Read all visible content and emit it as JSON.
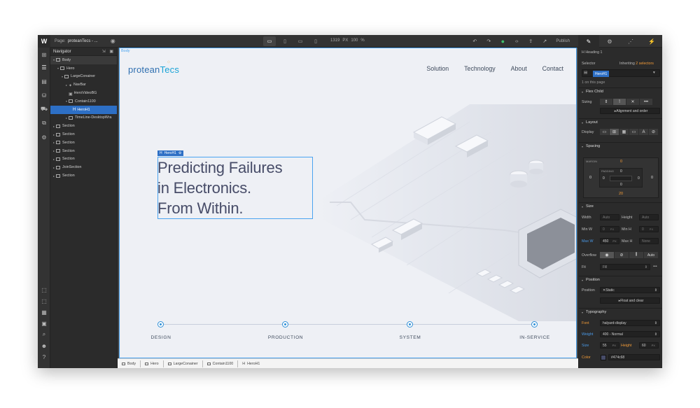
{
  "topbar": {
    "logo": "W",
    "page_label": "Page:",
    "page_name": "proteanTecs - ...",
    "width": "1319",
    "width_unit": "PX",
    "zoom": "100",
    "zoom_unit": "%",
    "publish_label": "Publish"
  },
  "navigator": {
    "title": "Navigator",
    "items": [
      {
        "label": "Body"
      },
      {
        "label": "Hero"
      },
      {
        "label": "LargeConainer"
      },
      {
        "label": "NavBar"
      },
      {
        "label": "HeroVideoBG"
      },
      {
        "label": "Contain1100"
      },
      {
        "label": "HeroH1"
      },
      {
        "label": "TimeLine-DesktopWra"
      },
      {
        "label": "Section"
      },
      {
        "label": "Section"
      },
      {
        "label": "Section"
      },
      {
        "label": "Section"
      },
      {
        "label": "Section"
      },
      {
        "label": "JoinSection"
      },
      {
        "label": "Section"
      }
    ]
  },
  "canvas": {
    "body_tag": "Body",
    "brand_part1": "protean",
    "brand_part2": "Tecs",
    "menu": [
      "Solution",
      "Technology",
      "About",
      "Contact"
    ],
    "selected_tag": "HeroH1",
    "hero_line1": "Predicting Failures",
    "hero_line2": "in Electronics.",
    "hero_line3": "From Within.",
    "timeline": [
      "DESIGN",
      "PRODUCTION",
      "SYSTEM",
      "IN-SERVICE"
    ]
  },
  "breadcrumbs": [
    "Body",
    "Hero",
    "LargeConainer",
    "Contain1100",
    "HeroH1"
  ],
  "rpanel": {
    "element_type": "Heading 1",
    "selector_label": "Selector",
    "inheriting_label": "Inheriting",
    "inheriting_count": "2 selectors",
    "selector_chip": "HeroH1",
    "on_this_page": "1 on this page",
    "flex_child": "Flex Child",
    "sizing": "Sizing",
    "alignment_order": "Alignment and order",
    "layout": "Layout",
    "display": "Display",
    "spacing": "Spacing",
    "margin_label": "MARGIN",
    "padding_label": "PADDING",
    "margin_top": "0",
    "margin_bottom": "20",
    "margin_left": "0",
    "margin_right": "0",
    "padding_top": "0",
    "padding_bottom": "0",
    "padding_left": "0",
    "padding_right": "0",
    "size": "Size",
    "width_label": "Width",
    "width_val": "Auto",
    "height_label": "Height",
    "height_val": "Auto",
    "minw_label": "Min W",
    "minw_val": "0",
    "minh_label": "Min H",
    "minh_val": "0",
    "maxw_label": "Max W",
    "maxw_val": "450",
    "maxh_label": "Max H",
    "maxh_val": "None",
    "px": "PX",
    "overflow_label": "Overflow",
    "overflow_auto": "Auto",
    "fit_label": "Fit",
    "fit_val": "Fill",
    "position": "Position",
    "position_label": "Position",
    "position_val": "Static",
    "float_clear": "Float and clear",
    "typography": "Typography",
    "font_label": "Font",
    "font_val": "halyard-display",
    "weight_label": "Weight",
    "weight_val": "400 - Normal",
    "size_label": "Size",
    "size_val": "55",
    "height_lbl": "Height",
    "line_height_val": "60",
    "color_label": "Color",
    "color_val": "#474c68"
  },
  "colors": {
    "accent": "#2d6fc5",
    "hero_text": "#474c68",
    "timeline_dot": "#2f8fd7",
    "published_ok": "#3fc06d"
  }
}
